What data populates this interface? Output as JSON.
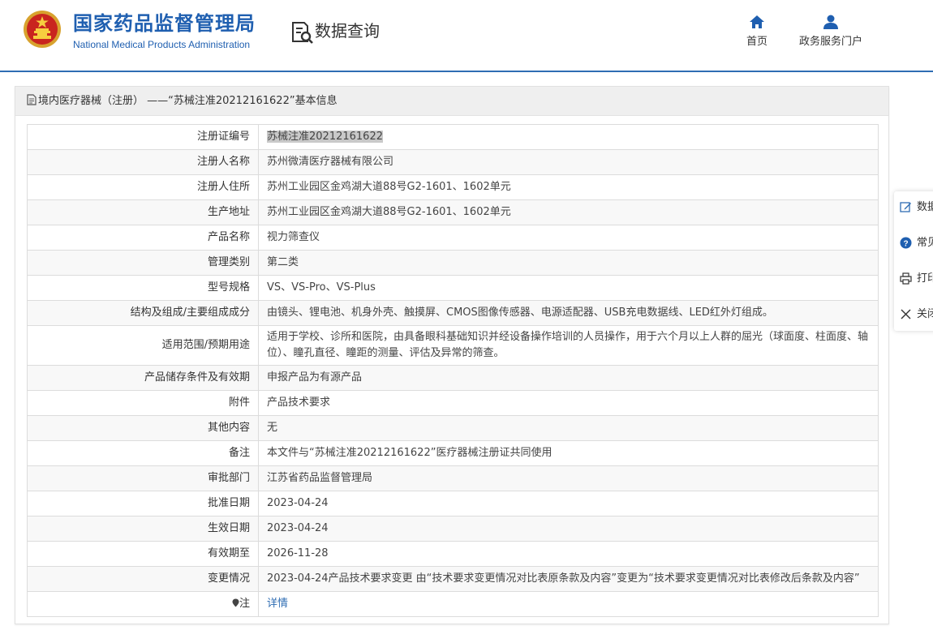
{
  "header": {
    "org_name_cn": "国家药品监督管理局",
    "org_name_en": "National Medical Products Administration",
    "section_title": "数据查询",
    "nav": [
      {
        "label": "首页",
        "icon": "home-icon"
      },
      {
        "label": "政务服务门户",
        "icon": "user-icon"
      }
    ]
  },
  "panel": {
    "title": "境内医疗器械（注册） ——“苏械注准20212161622”基本信息"
  },
  "rows": [
    {
      "label": "注册证编号",
      "value": "苏械注准20212161622"
    },
    {
      "label": "注册人名称",
      "value": "苏州微清医疗器械有限公司"
    },
    {
      "label": "注册人住所",
      "value": "苏州工业园区金鸡湖大道88号G2-1601、1602单元"
    },
    {
      "label": "生产地址",
      "value": "苏州工业园区金鸡湖大道88号G2-1601、1602单元"
    },
    {
      "label": "产品名称",
      "value": "视力筛查仪"
    },
    {
      "label": "管理类别",
      "value": "第二类"
    },
    {
      "label": "型号规格",
      "value": "VS、VS-Pro、VS-Plus"
    },
    {
      "label": "结构及组成/主要组成成分",
      "value": "由镜头、锂电池、机身外壳、触摸屏、CMOS图像传感器、电源适配器、USB充电数据线、LED红外灯组成。"
    },
    {
      "label": "适用范围/预期用途",
      "value": "适用于学校、诊所和医院，由具备眼科基础知识并经设备操作培训的人员操作，用于六个月以上人群的屈光（球面度、柱面度、轴位）、瞳孔直径、瞳距的测量、评估及异常的筛查。"
    },
    {
      "label": "产品储存条件及有效期",
      "value": "申报产品为有源产品"
    },
    {
      "label": "附件",
      "value": "产品技术要求"
    },
    {
      "label": "其他内容",
      "value": "无"
    },
    {
      "label": "备注",
      "value": "本文件与“苏械注准20212161622”医疗器械注册证共同使用"
    },
    {
      "label": "审批部门",
      "value": "江苏省药品监督管理局"
    },
    {
      "label": "批准日期",
      "value": "2023-04-24"
    },
    {
      "label": "生效日期",
      "value": "2023-04-24"
    },
    {
      "label": "有效期至",
      "value": "2026-11-28"
    },
    {
      "label": "变更情况",
      "value": "2023-04-24产品技术要求变更 由“技术要求变更情况对比表原条款及内容”变更为“技术要求变更情况对比表修改后条款及内容”"
    },
    {
      "label": "注",
      "value": "详情"
    }
  ],
  "side_menu": [
    {
      "label": "数据",
      "icon": "edit-icon"
    },
    {
      "label": "常见",
      "icon": "help-icon"
    },
    {
      "label": "打印",
      "icon": "print-icon"
    },
    {
      "label": "关闭",
      "icon": "close-icon"
    }
  ]
}
